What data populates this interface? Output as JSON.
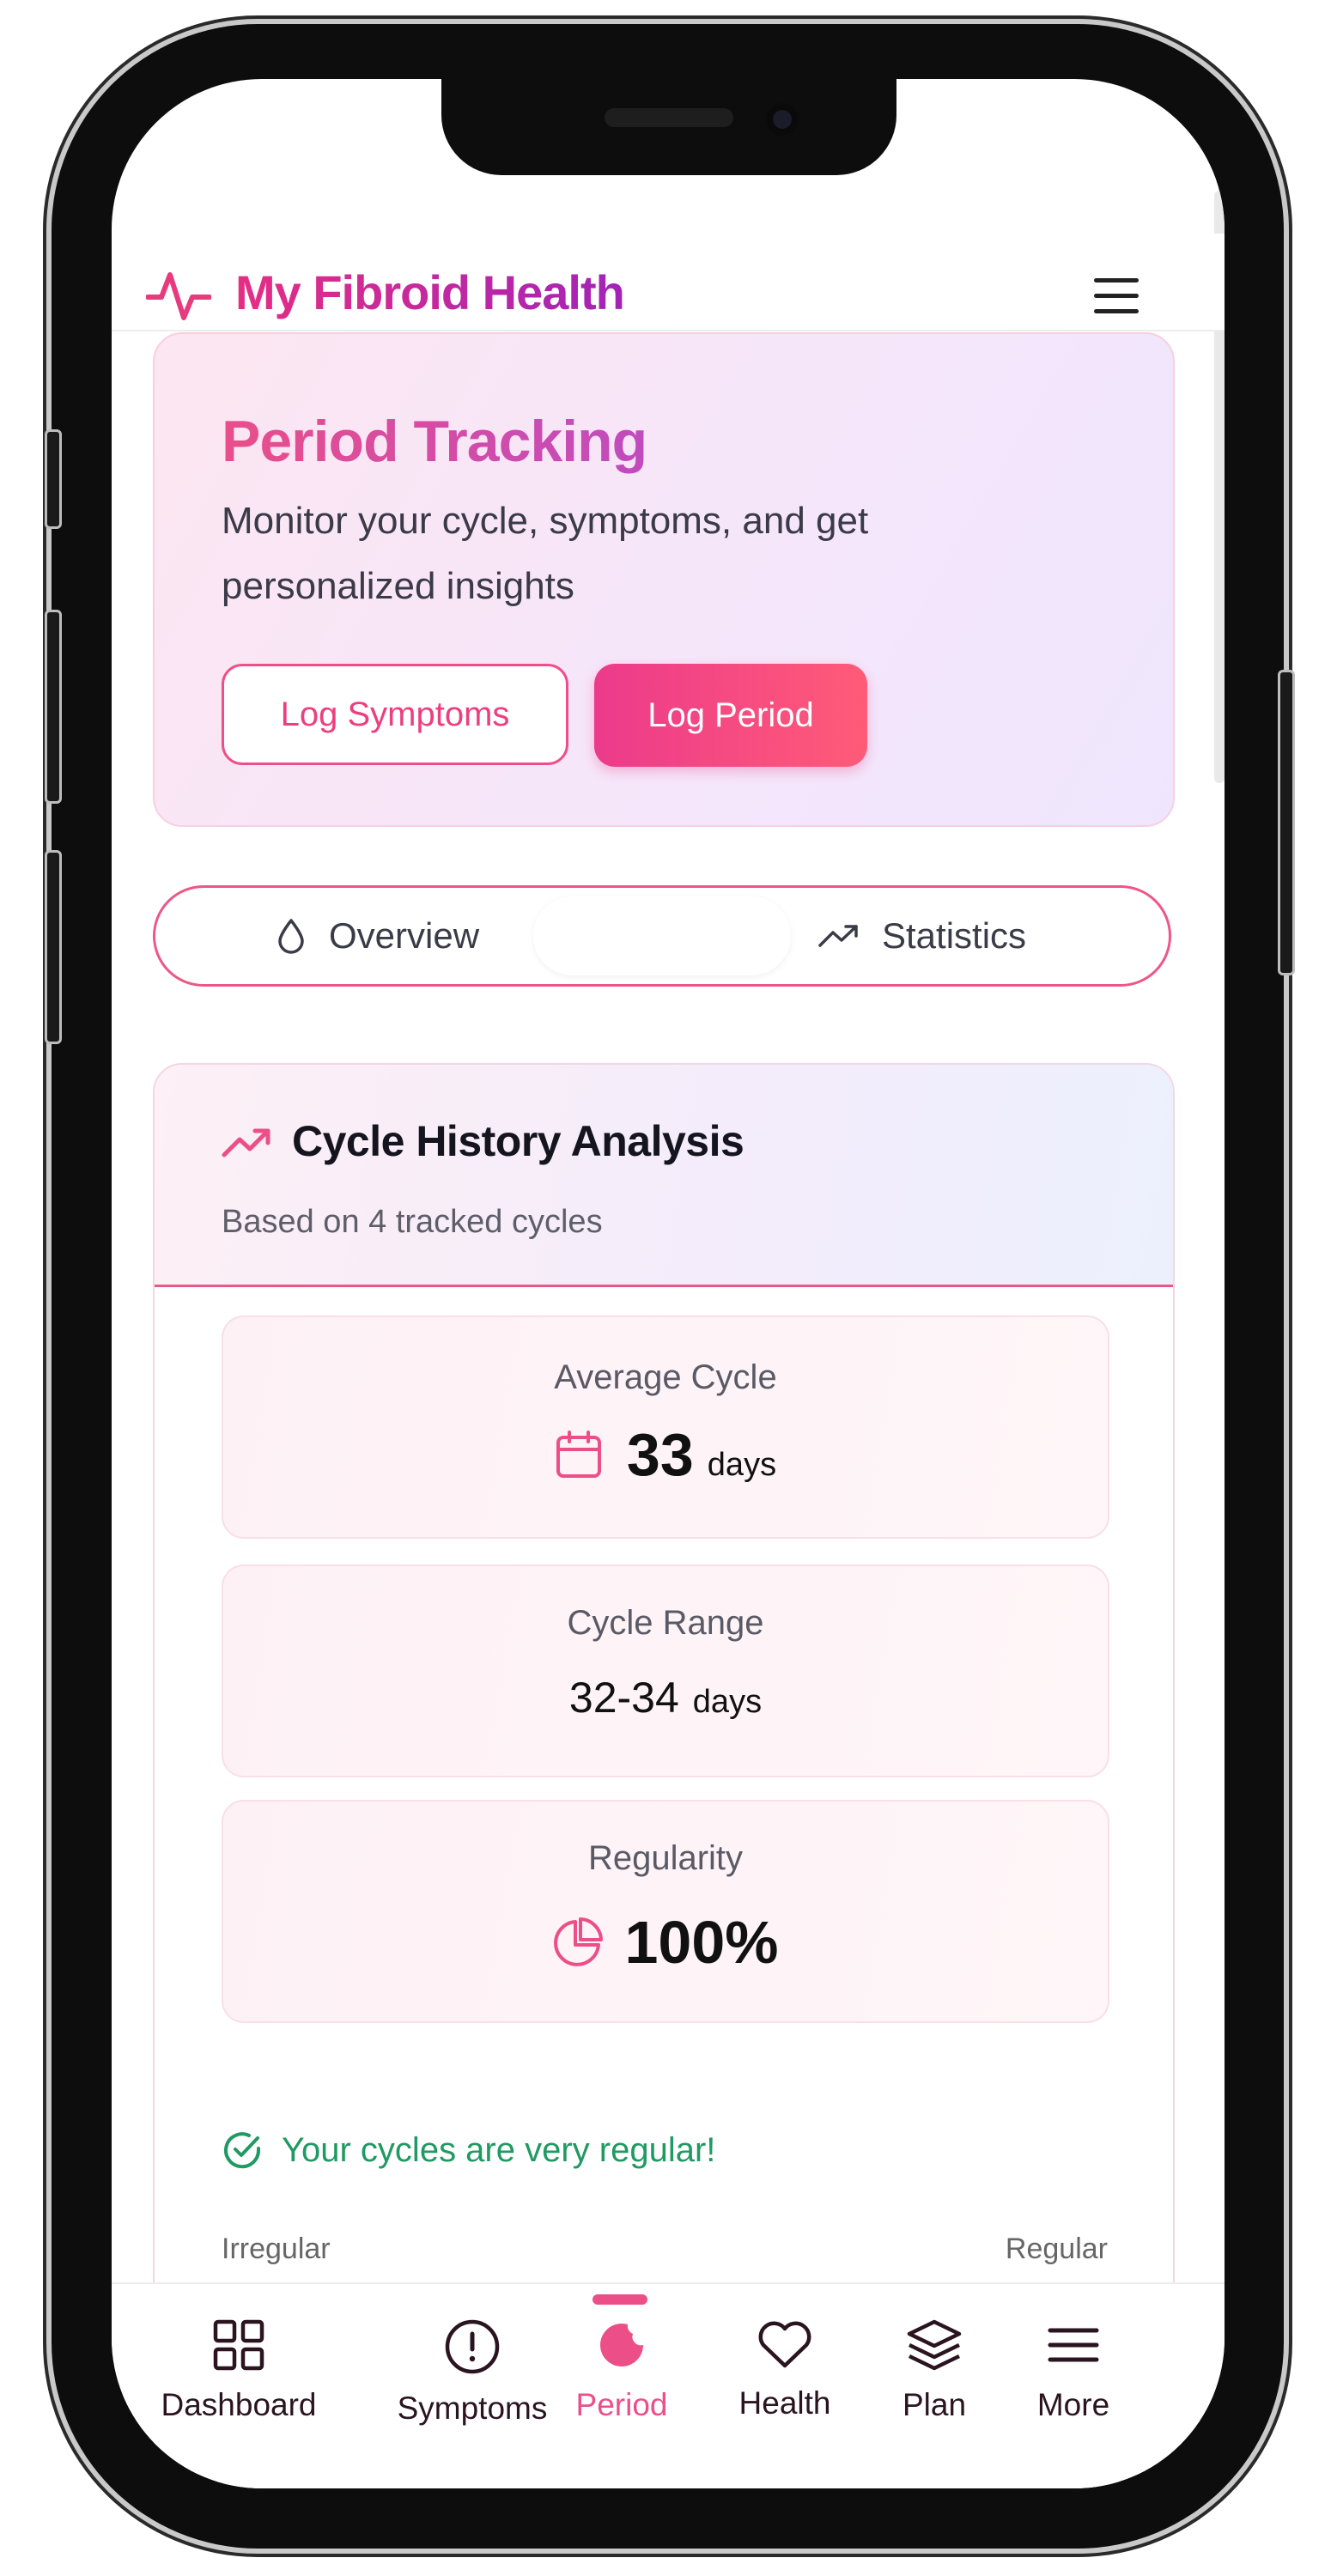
{
  "header": {
    "app_title": "My Fibroid Health"
  },
  "hero": {
    "title": "Period Tracking",
    "subtitle": "Monitor your cycle, symptoms, and get personalized insights",
    "log_symptoms_label": "Log Symptoms",
    "log_period_label": "Log Period"
  },
  "tabs": [
    {
      "label": "Overview",
      "icon": "droplet-icon"
    },
    {
      "label": "Statistics",
      "icon": "trending-up-icon"
    }
  ],
  "analysis": {
    "title": "Cycle History Analysis",
    "subtitle": "Based on 4 tracked cycles",
    "average": {
      "label": "Average Cycle",
      "value": "33",
      "unit": "days",
      "icon": "calendar-icon"
    },
    "range": {
      "label": "Cycle Range",
      "value": "32-34",
      "unit": "days"
    },
    "regularity": {
      "label": "Regularity",
      "value": "100%",
      "icon": "pie-chart-icon"
    },
    "message": "Your cycles are very regular!",
    "scale_left": "Irregular",
    "scale_right": "Regular"
  },
  "nav": [
    {
      "label": "Dashboard",
      "icon": "grid-icon"
    },
    {
      "label": "Symptoms",
      "icon": "alert-circle-icon"
    },
    {
      "label": "Period",
      "icon": "period-icon",
      "active": true
    },
    {
      "label": "Health",
      "icon": "heart-icon"
    },
    {
      "label": "Plan",
      "icon": "layers-icon"
    },
    {
      "label": "More",
      "icon": "menu-icon"
    }
  ],
  "colors": {
    "accent": "#ec4f87",
    "brand_start": "#e52e84",
    "brand_end": "#a323b8",
    "success": "#1f9a62"
  }
}
